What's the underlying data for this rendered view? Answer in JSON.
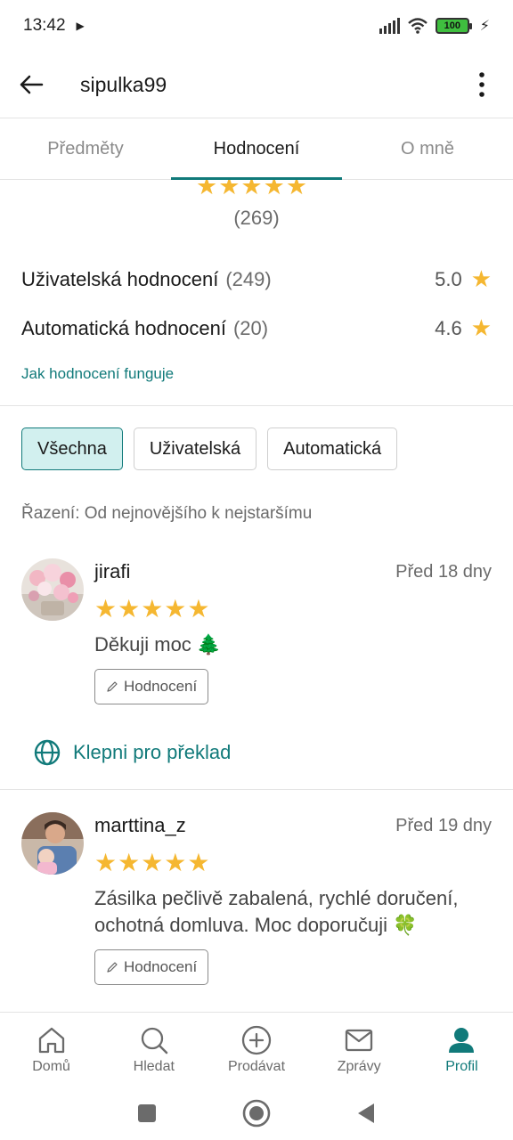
{
  "status_bar": {
    "time": "13:42",
    "battery": "100"
  },
  "header": {
    "title": "sipulka99"
  },
  "tabs": [
    {
      "label": "Předměty",
      "active": false
    },
    {
      "label": "Hodnocení",
      "active": true
    },
    {
      "label": "O mně",
      "active": false
    }
  ],
  "summary": {
    "stars": "★★★★★",
    "total": "(269)",
    "user_label": "Uživatelská hodnocení",
    "user_count": "(249)",
    "user_score": "5.0",
    "auto_label": "Automatická hodnocení",
    "auto_count": "(20)",
    "auto_score": "4.6",
    "how_link": "Jak hodnocení funguje"
  },
  "filters": [
    {
      "label": "Všechna",
      "active": true
    },
    {
      "label": "Uživatelská",
      "active": false
    },
    {
      "label": "Automatická",
      "active": false
    }
  ],
  "sort_text": "Řazení: Od nejnovějšího k nejstaršímu",
  "reviews": [
    {
      "user": "jirafi",
      "date": "Před 18 dny",
      "stars": "★★★★★",
      "text": "Děkuji moc 🌲",
      "tag": "Hodnocení",
      "translate": "Klepni pro překlad"
    },
    {
      "user": "marttina_z",
      "date": "Před 19 dny",
      "stars": "★★★★★",
      "text": "Zásilka pečlivě zabalená, rychlé doručení, ochotná domluva. Moc doporučuji 🍀",
      "tag": "Hodnocení"
    }
  ],
  "bottom_nav": [
    {
      "label": "Domů",
      "icon": "home-icon",
      "active": false
    },
    {
      "label": "Hledat",
      "icon": "search-icon",
      "active": false
    },
    {
      "label": "Prodávat",
      "icon": "plus-circle-icon",
      "active": false
    },
    {
      "label": "Zprávy",
      "icon": "mail-icon",
      "active": false
    },
    {
      "label": "Profil",
      "icon": "person-icon",
      "active": true
    }
  ],
  "colors": {
    "accent": "#117a7a",
    "star": "#f5b731",
    "chip_active_bg": "#d2f0ef"
  }
}
